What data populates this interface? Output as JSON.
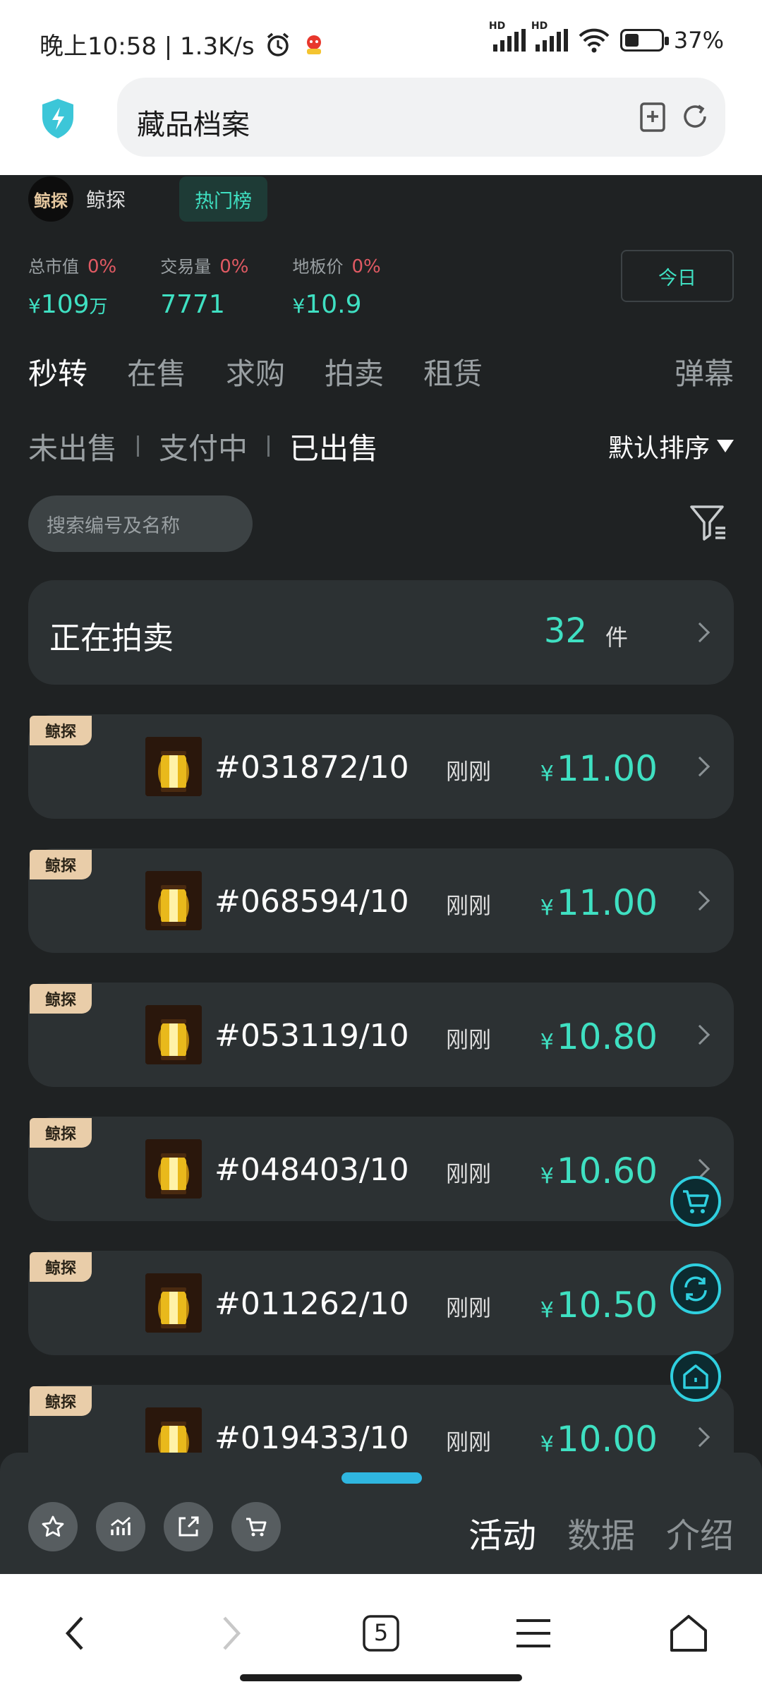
{
  "status_bar": {
    "left_text": "晚上10:58 | 1.3K/s",
    "battery_pct": "37%",
    "battery_level": 0.37,
    "icons": [
      "alarm-icon",
      "app-notification-icon",
      "signal-hd-icon",
      "signal-hd-icon",
      "wifi-icon",
      "battery-icon"
    ]
  },
  "browser": {
    "page_title": "藏品档案",
    "tab_count": "5"
  },
  "header": {
    "logo_text": "鲸探",
    "brand": "鲸探",
    "hot_list": "热门榜"
  },
  "stats": [
    {
      "label": "总市值",
      "pct": "0%",
      "currency": "¥",
      "value": "109",
      "unit": "万"
    },
    {
      "label": "交易量",
      "pct": "0%",
      "currency": "",
      "value": "7771",
      "unit": ""
    },
    {
      "label": "地板价",
      "pct": "0%",
      "currency": "¥",
      "value": "10.9",
      "unit": ""
    }
  ],
  "today_button": "今日",
  "tabs": [
    "秒转",
    "在售",
    "求购",
    "拍卖",
    "租赁"
  ],
  "danmu": "弹幕",
  "subtabs": [
    "未出售",
    "支付中",
    "已出售"
  ],
  "sort_label": "默认排序",
  "search_placeholder": "搜索编号及名称",
  "auction_banner": {
    "label": "正在拍卖",
    "count": "32",
    "unit": "件"
  },
  "items": [
    {
      "tag": "鲸探",
      "serial": "#031872/10",
      "time": "刚刚",
      "currency": "¥",
      "price": "11.00"
    },
    {
      "tag": "鲸探",
      "serial": "#068594/10",
      "time": "刚刚",
      "currency": "¥",
      "price": "11.00"
    },
    {
      "tag": "鲸探",
      "serial": "#053119/10",
      "time": "刚刚",
      "currency": "¥",
      "price": "10.80"
    },
    {
      "tag": "鲸探",
      "serial": "#048403/10",
      "time": "刚刚",
      "currency": "¥",
      "price": "10.60"
    },
    {
      "tag": "鲸探",
      "serial": "#011262/10",
      "time": "刚刚",
      "currency": "¥",
      "price": "10.50"
    },
    {
      "tag": "鲸探",
      "serial": "#019433/10",
      "time": "刚刚",
      "currency": "¥",
      "price": "10.00"
    }
  ],
  "bottom_panel": {
    "tabs": [
      "活动",
      "数据",
      "介绍"
    ],
    "action_icons": [
      "star-icon",
      "chart-icon",
      "share-icon",
      "cart-icon"
    ]
  },
  "colors": {
    "accent": "#3fe0c2",
    "down": "#e05a63",
    "background": "#1f2223",
    "card": "#2c3133"
  }
}
